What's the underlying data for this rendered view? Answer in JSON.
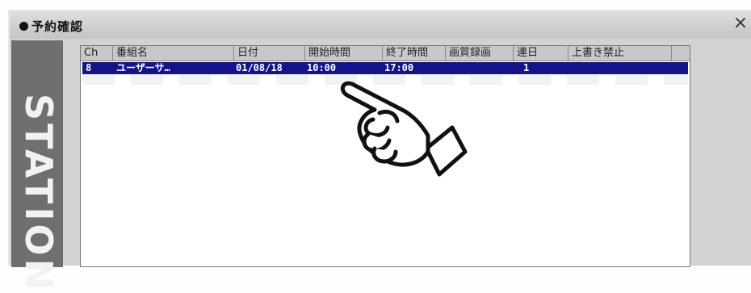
{
  "window": {
    "title": "予約確認",
    "close_glyph": "×",
    "side_brand": "STATION"
  },
  "list": {
    "columns": [
      "Ch",
      "番組名",
      "日付",
      "開始時間",
      "終了時間",
      "画質録画",
      "連日",
      "上書き禁止"
    ],
    "rows": [
      {
        "ch": "8",
        "name": "ユーザーサ…",
        "date": "01/08/18",
        "start": "10:00",
        "end": "17:00",
        "quality": "",
        "repeat": "1",
        "protect": ""
      }
    ]
  },
  "icons": {
    "pointer": "pointing-hand-icon"
  }
}
